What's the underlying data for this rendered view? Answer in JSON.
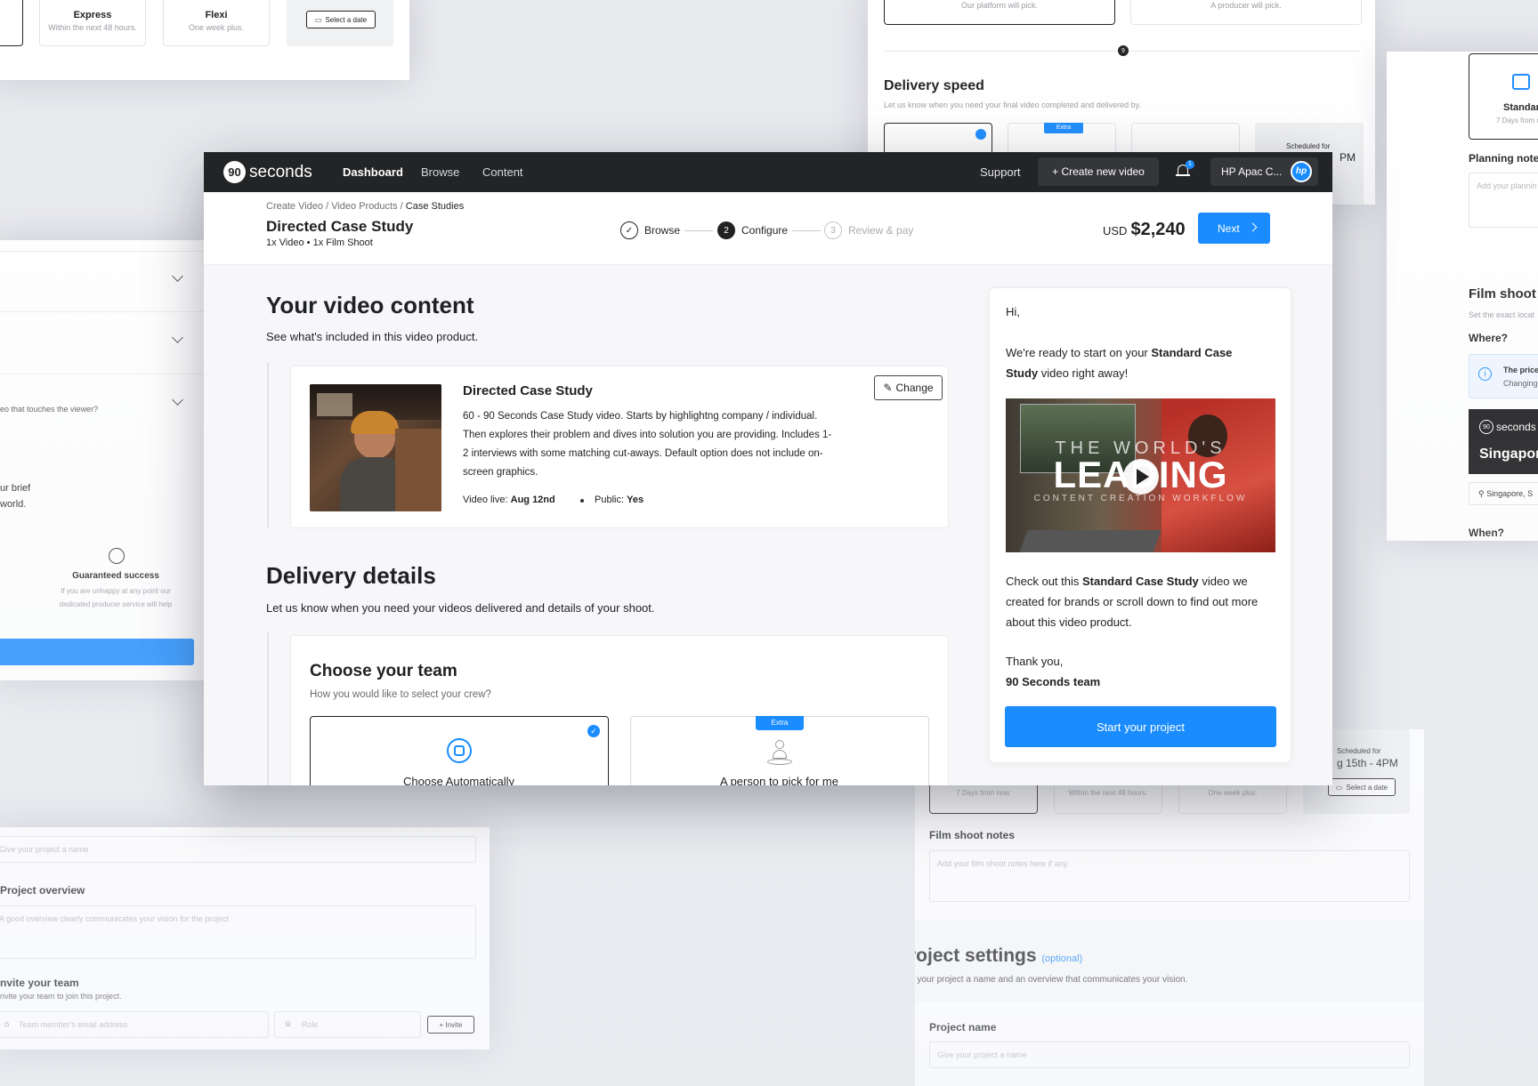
{
  "colors": {
    "accent": "#1a8cff",
    "nav_bg": "#232426",
    "extra_badge": "#1a8cff",
    "photo_red": "#c9382f"
  },
  "bg_top_left": {
    "cards": [
      {
        "title": "Express",
        "sub": "Within the next 48 hours."
      },
      {
        "title": "Flexi",
        "sub": "One week plus."
      }
    ],
    "select_date": "Select a date"
  },
  "bg_top_right": {
    "cards": [
      {
        "sub": "Our platform will pick."
      },
      {
        "sub": "A producer will pick."
      }
    ],
    "section_title": "Delivery speed",
    "section_sub": "Let us know when you need your final video completed and delivered by.",
    "extra": "Extra",
    "scheduled": "Scheduled for",
    "time_fragment": "PM"
  },
  "bg_right_strip": {
    "card_title": "Standar",
    "card_sub": "7 Days from n",
    "notes_label": "Planning notes",
    "notes_placeholder": "Add your plannin",
    "film_title": "Film shoot",
    "film_sub": "Set the exact locat",
    "where": "Where?",
    "info_title": "The price",
    "info_sub": "Changing",
    "banner_brand": "seconds",
    "banner_city": "Singapor",
    "loc": "Singapore, S",
    "when": "When?"
  },
  "bg_left": {
    "question": "eo that touches the viewer?",
    "brief1": "ur brief",
    "brief2": "world.",
    "guarantee_title": "Guaranteed success",
    "guarantee_text1": "If you are unhappy at any point our",
    "guarantee_text2": "dedicated producer service will help"
  },
  "bg_bottom_left": {
    "name_placeholder": "Give your project a name",
    "overview_label": "Project overview",
    "overview_placeholder": "A good overview clearly communicates your vision for the project",
    "invite_label": "nvite your team",
    "invite_sub": "nvite your team to join this project.",
    "email_placeholder": "Team member's email address",
    "role_placeholder": "Role",
    "invite_btn": "+ Invite"
  },
  "bg_bottom_right": {
    "cards": [
      {
        "sub": "7 Days from now."
      },
      {
        "sub": "Within the next 48 hours."
      },
      {
        "sub": "One week plus."
      }
    ],
    "scheduled": "Scheduled for",
    "scheduled_date": "g 15th - 4PM",
    "select_date": "Select a date",
    "notes_label": "Film shoot notes",
    "notes_placeholder": "Add your film shoot notes here if any.",
    "settings_title": "Project settings",
    "settings_optional": "(optional)",
    "settings_sub": "Give your project a name and an overview that communicates your vision.",
    "name_label": "Project name",
    "name_placeholder": "Give your project a name"
  },
  "nav": {
    "logo_mark": "90",
    "logo_text": "seconds",
    "links": [
      "Dashboard",
      "Browse",
      "Content"
    ],
    "support": "Support",
    "create": "+ Create new video",
    "notif_count": "1",
    "account": "HP Apac C...",
    "account_logo": "hp"
  },
  "header": {
    "breadcrumb": [
      "Create Video",
      "/",
      "Video Products",
      "/",
      "Case Studies"
    ],
    "title": "Directed Case Study",
    "subtitle": "1x Video • 1x Film Shoot",
    "steps": [
      {
        "num": "",
        "label": "Browse",
        "state": "done"
      },
      {
        "num": "2",
        "label": "Configure",
        "state": "active"
      },
      {
        "num": "3",
        "label": "Review & pay",
        "state": "todo"
      }
    ],
    "currency": "USD",
    "price": "$2,240",
    "next": "Next"
  },
  "content": {
    "title": "Your video content",
    "sub": "See what's included in this video product.",
    "product": {
      "name": "Directed Case Study",
      "desc": "60 - 90 Seconds Case Study video. Starts by highlightng company / individual. Then explores their problem and dives into solution you are providing.  Includes 1-2 interviews with some matching cut-aways. Default option does not include on-screen graphics.",
      "change": "Change",
      "live_label": "Video live:",
      "live_value": "Aug 12nd",
      "public_label": "Public:",
      "public_value": "Yes"
    }
  },
  "delivery": {
    "title": "Delivery details",
    "sub": "Let us know when you need your videos delivered and details of your shoot.",
    "team_title": "Choose your team",
    "team_sub": "How you would like to select your crew?",
    "options": [
      {
        "label": "Choose Automatically",
        "selected": true
      },
      {
        "label": "A person to pick for me",
        "extra": "Extra"
      }
    ]
  },
  "chat": {
    "hi": "Hi,",
    "p1_a": "We're ready to start on your ",
    "p1_b": "Standard Case Study",
    "p1_c": " video right away!",
    "video_line1": "THE WORLD'S",
    "video_line2": "LEADING",
    "video_line3": "CONTENT CREATION WORKFLOW",
    "p2_a": "Check out this ",
    "p2_b": "Standard Case Study",
    "p2_c": " video we created for brands or scroll down to find out more about this video product.",
    "thanks": "Thank you,",
    "team": "90 Seconds team",
    "cta": "Start your project"
  }
}
